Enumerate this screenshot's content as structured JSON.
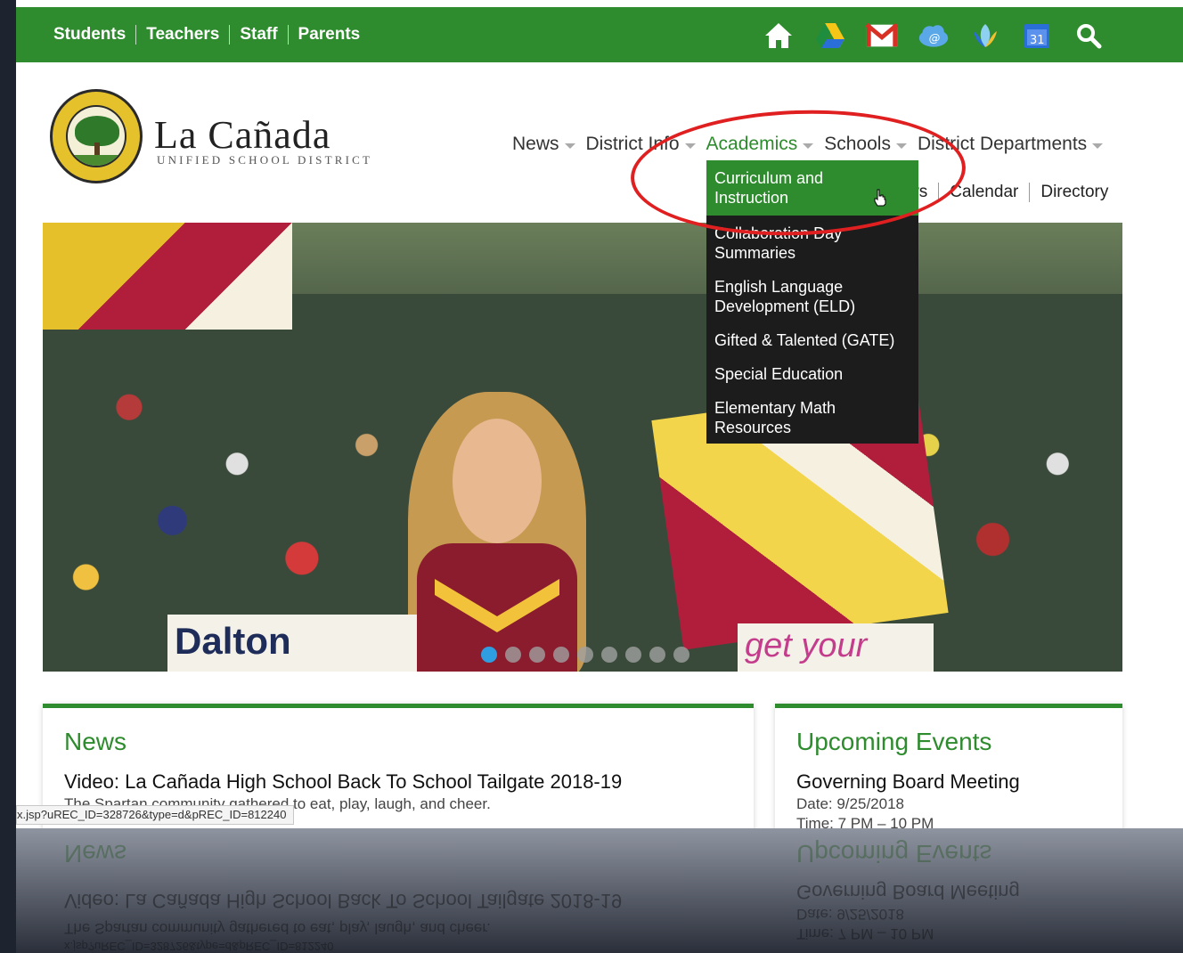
{
  "topbar": {
    "links": [
      "Students",
      "Teachers",
      "Staff",
      "Parents"
    ],
    "icons": [
      "home-icon",
      "google-drive-icon",
      "gmail-icon",
      "cloud-icon",
      "tulip-icon",
      "calendar-icon",
      "search-icon"
    ],
    "calendar_day": "31",
    "bg_color": "#2e8b2e"
  },
  "brand": {
    "name": "La Cañada",
    "subtitle": "UNIFIED SCHOOL DISTRICT"
  },
  "mainnav": {
    "items": [
      "News",
      "District Info",
      "Academics",
      "Schools",
      "District Departments"
    ],
    "active": "Academics"
  },
  "subnav": {
    "items": [
      "ws",
      "Calendar",
      "Directory"
    ]
  },
  "dropdown": {
    "items": [
      [
        "Curriculum and",
        "Instruction"
      ],
      [
        "Collaboration Day",
        "Summaries"
      ],
      [
        "English Language",
        "Development (ELD)"
      ],
      [
        "Gifted & Talented (GATE)"
      ],
      [
        "Special Education"
      ],
      [
        "Elementary Math",
        "Resources"
      ]
    ]
  },
  "hero": {
    "banner_left": "Dalton",
    "banner_right": "get your",
    "slide_count": 9,
    "active_slide": 1
  },
  "news": {
    "heading": "News",
    "title": "Video: La Cañada High School Back To School Tailgate 2018-19",
    "summary": "The Spartan community gathered to eat, play, laugh, and cheer."
  },
  "events": {
    "heading": "Upcoming Events",
    "title": "Governing Board Meeting",
    "date": "Date: 9/25/2018",
    "time": "Time: 7 PM – 10 PM"
  },
  "statusbar": {
    "url": "x.jsp?uREC_ID=328726&type=d&pREC_ID=812240"
  }
}
